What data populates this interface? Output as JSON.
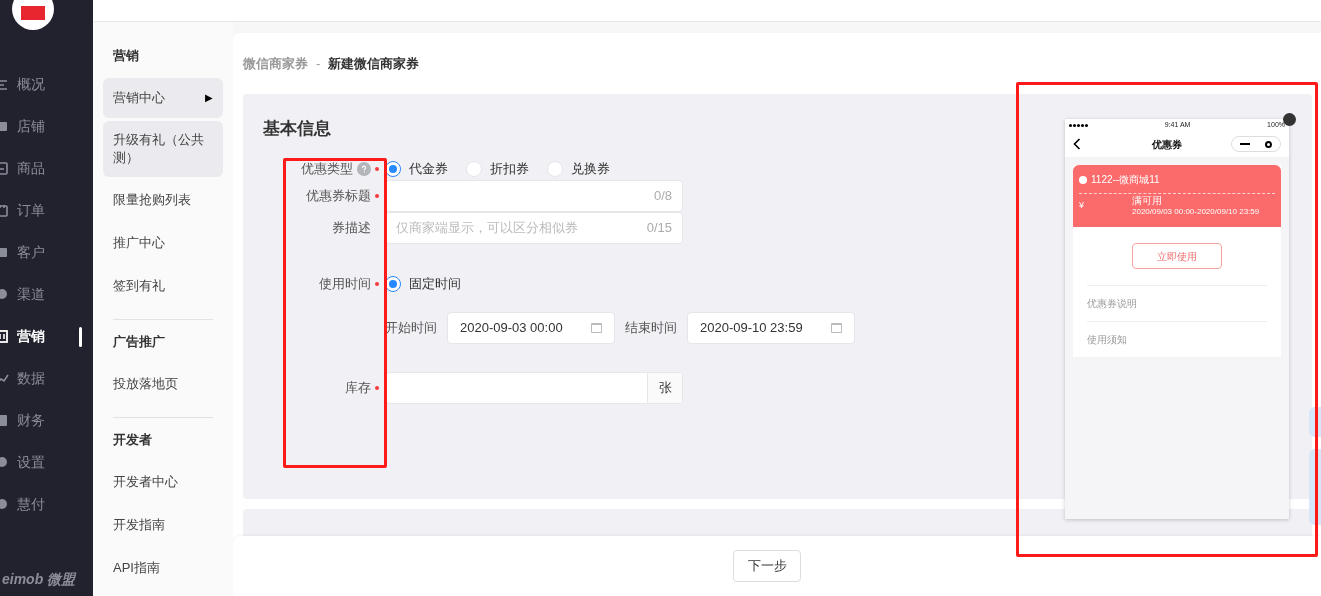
{
  "nav": {
    "items": [
      {
        "label": "概况",
        "selected": false
      },
      {
        "label": "店铺",
        "selected": false
      },
      {
        "label": "商品",
        "selected": false
      },
      {
        "label": "订单",
        "selected": false
      },
      {
        "label": "客户",
        "selected": false
      },
      {
        "label": "渠道",
        "selected": false
      },
      {
        "label": "营销",
        "selected": true
      },
      {
        "label": "数据",
        "selected": false
      },
      {
        "label": "财务",
        "selected": false
      },
      {
        "label": "设置",
        "selected": false
      },
      {
        "label": "慧付",
        "selected": false
      }
    ],
    "brand": "eimob 微盟"
  },
  "subnav": {
    "sections": [
      {
        "title": "营销",
        "items": [
          {
            "label": "营销中心",
            "selected": true,
            "arrow": "▶"
          },
          {
            "label": "升级有礼（公共测）",
            "selected": true
          },
          {
            "label": "限量抢购列表",
            "selected": false
          },
          {
            "label": "推广中心",
            "selected": false
          },
          {
            "label": "签到有礼",
            "selected": false
          }
        ]
      },
      {
        "title": "广告推广",
        "items": [
          {
            "label": "投放落地页",
            "selected": false
          }
        ]
      },
      {
        "title": "开发者",
        "items": [
          {
            "label": "开发者中心",
            "selected": false
          },
          {
            "label": "开发指南",
            "selected": false
          },
          {
            "label": "API指南",
            "selected": false
          }
        ]
      }
    ]
  },
  "breadcrumb": {
    "parent": "微信商家券",
    "separator": "-",
    "current": "新建微信商家券"
  },
  "form": {
    "title": "基本信息",
    "coupon_type": {
      "label": "优惠类型",
      "options": [
        {
          "label": "代金券",
          "selected": true
        },
        {
          "label": "折扣券",
          "selected": false
        },
        {
          "label": "兑换券",
          "selected": false
        }
      ]
    },
    "title_field": {
      "label": "优惠券标题",
      "counter": "0/8"
    },
    "description": {
      "label": "券描述",
      "placeholder": "仅商家端显示，可以区分相似券",
      "counter": "0/15"
    },
    "use_time": {
      "label": "使用时间",
      "options": [
        {
          "label": "固定时间",
          "selected": true
        }
      ],
      "start_label": "开始时间",
      "start": "2020-09-03 00:00",
      "end_label": "结束时间",
      "end": "2020-09-10 23:59"
    },
    "stock": {
      "label": "库存",
      "unit": "张"
    }
  },
  "preview": {
    "status_time": "9:41 AM",
    "battery": "100%",
    "title": "优惠券",
    "shop": "1122--微商城11",
    "currency": "¥",
    "condition": "满可用",
    "period": "2020/09/03 00:00-2020/09/10 23:59",
    "use_button": "立即使用",
    "sections": [
      "优惠券说明",
      "使用须知"
    ]
  },
  "footer": {
    "next_button": "下一步"
  }
}
